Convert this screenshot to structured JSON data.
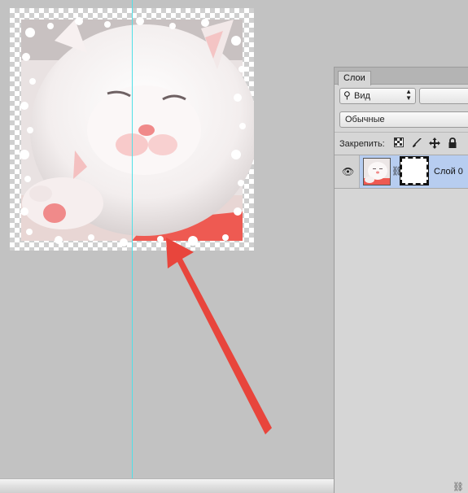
{
  "canvas": {
    "guide_color": "#4fe0e8",
    "arrow_color": "#e8453c"
  },
  "layers_panel": {
    "tab_label": "Слои",
    "filter": {
      "icon": "search-icon",
      "value": "Вид"
    },
    "blend_mode": "Обычные",
    "lock_label": "Закрепить:",
    "lock_icons": [
      "lock-transparent-pixels-icon",
      "lock-image-pixels-icon",
      "lock-position-icon",
      "lock-all-icon"
    ],
    "layers": [
      {
        "name": "Слой 0",
        "visible": true,
        "selected": true,
        "has_mask": true
      }
    ]
  },
  "colors": {
    "panel_bg": "#d6d6d6",
    "selected_layer": "#b7cdf0",
    "workspace": "#c2c2c2"
  }
}
